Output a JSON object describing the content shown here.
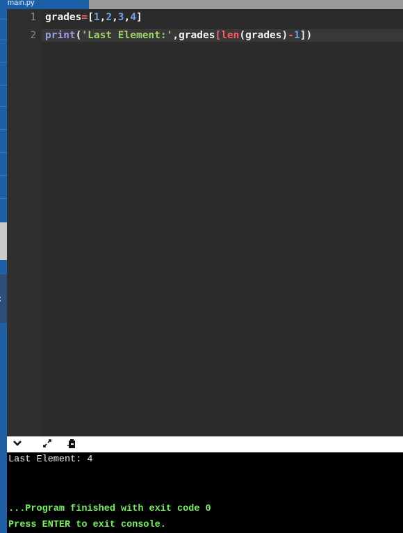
{
  "tab": {
    "filename": "main.py"
  },
  "editor": {
    "lines": [
      {
        "number": "1"
      },
      {
        "number": "2"
      }
    ]
  },
  "code_tokens": {
    "l1": [
      "grades",
      "=",
      "[",
      "1",
      ",",
      "2",
      ",",
      "3",
      ",",
      "4",
      "]"
    ],
    "l2": [
      "print",
      "(",
      "'Last Element:'",
      ",",
      "grades",
      "[",
      "len",
      "(",
      "grades",
      ")",
      "-",
      "1",
      "])"
    ]
  },
  "console_toolbar": {
    "icons": [
      "chevron-down-icon",
      "expand-icon",
      "clipboard-icon"
    ]
  },
  "console": {
    "output": "Last Element: 4",
    "finished": "...Program finished with exit code 0",
    "prompt": "Press ENTER to exit console."
  },
  "colors": {
    "editor_bg": "#2b2b2b",
    "tab_active": "#1b5fa8",
    "keyword": "#9d9ee8",
    "string": "#9ed36a",
    "number": "#6fa0e8",
    "console_green": "#75f25c"
  }
}
